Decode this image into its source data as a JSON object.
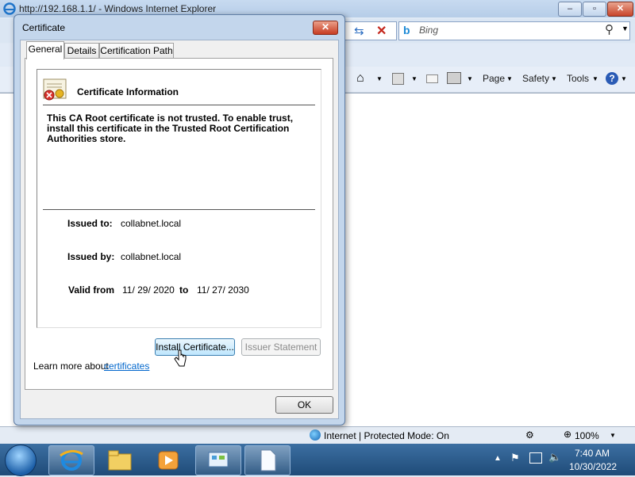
{
  "browser": {
    "title": "http://192.168.1.1/ - Windows Internet Explorer",
    "search_placeholder": "Bing",
    "command_bar": {
      "page": "Page",
      "safety": "Safety",
      "tools": "Tools"
    },
    "status": {
      "zone": "Internet | Protected Mode: On",
      "zoom": "100%"
    }
  },
  "dialog": {
    "title": "Certificate",
    "tabs": [
      "General",
      "Details",
      "Certification Path"
    ],
    "active_tab": "General",
    "heading": "Certificate Information",
    "warning": "This CA Root certificate is not trusted. To enable trust, install this certificate in the Trusted Root Certification Authorities store.",
    "issued_to_label": "Issued to:",
    "issued_to": "collabnet.local",
    "issued_by_label": "Issued by:",
    "issued_by": "collabnet.local",
    "valid_from_label": "Valid from",
    "valid_from": "11/ 29/ 2020",
    "valid_to_label": "to",
    "valid_to": "11/ 27/ 2030",
    "install_button": "Install Certificate...",
    "issuer_button": "Issuer Statement",
    "learn_more": "Learn more about",
    "learn_link": "certificates",
    "ok_button": "OK"
  },
  "taskbar": {
    "time": "7:40 AM",
    "date": "10/30/2022"
  },
  "colors": {
    "link": "#0066cc",
    "title_bar": "#c7daf0",
    "taskbar": "#2a5a8a"
  }
}
